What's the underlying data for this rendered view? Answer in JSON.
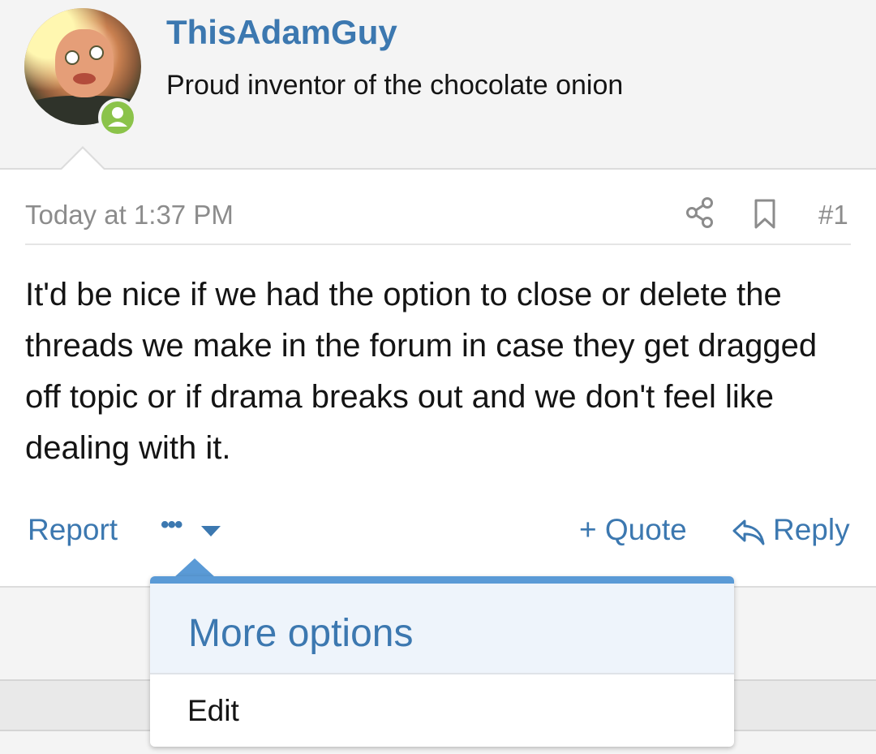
{
  "user": {
    "username": "ThisAdamGuy",
    "title": "Proud inventor of the chocolate onion"
  },
  "post": {
    "date": "Today at 1:37 PM",
    "number": "#1",
    "body": "It'd be nice if we had the option to close or delete the threads we make in the forum in case they get dragged off topic or if drama breaks out and we don't feel like dealing with it."
  },
  "actions": {
    "report": "Report",
    "more_dots": "•••",
    "quote": "+ Quote",
    "reply": "Reply"
  },
  "menu": {
    "title": "More options",
    "items": [
      {
        "label": "Edit"
      }
    ]
  },
  "icons": {
    "share": "share-icon",
    "bookmark": "bookmark-icon",
    "reply": "reply-arrow-icon",
    "online": "online-status-icon"
  },
  "colors": {
    "link": "#3c78b0",
    "online": "#8bc34a",
    "menu_accent": "#5a9ad6"
  }
}
